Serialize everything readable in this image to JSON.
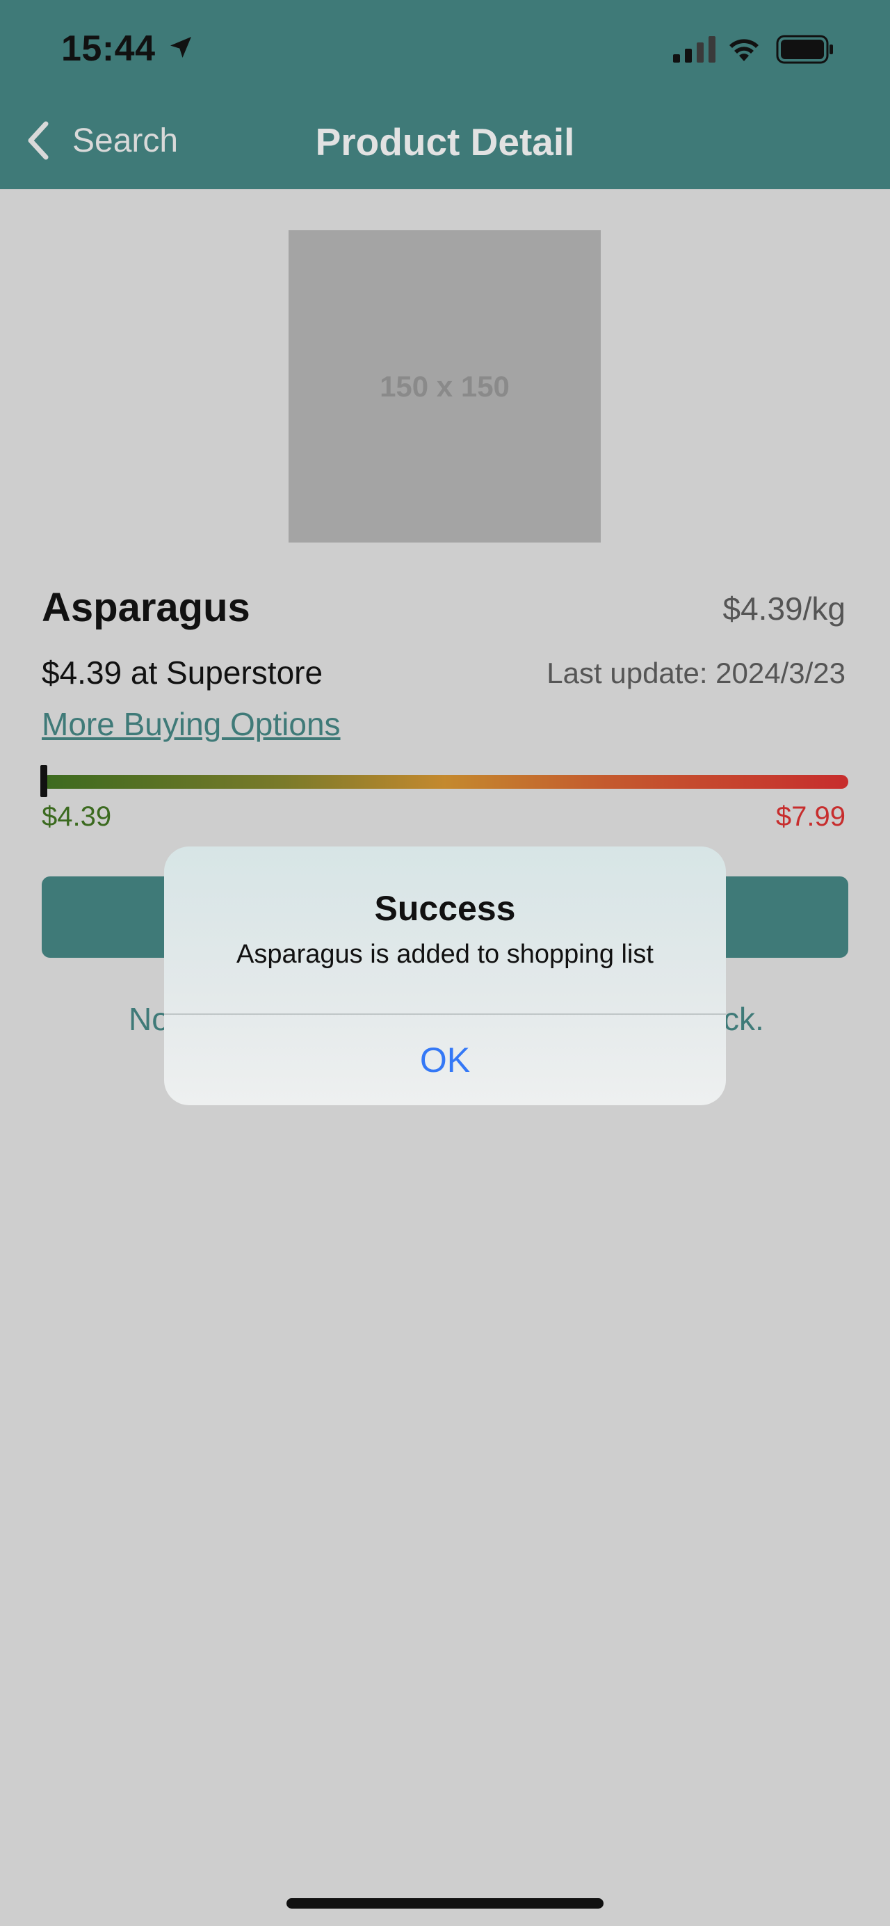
{
  "status_bar": {
    "time": "15:44",
    "icons": [
      "location-arrow-icon",
      "cellular-signal-icon",
      "wifi-icon",
      "battery-icon"
    ]
  },
  "nav": {
    "back_label": "Search",
    "title": "Product Detail",
    "back_icon": "chevron-left-icon"
  },
  "product": {
    "image_placeholder": "150 x 150",
    "name": "Asparagus",
    "unit_price": "$4.39/kg",
    "store_price": "$4.39 at Superstore",
    "last_update": "Last update: 2024/3/23",
    "more_options": "More Buying Options"
  },
  "price_range": {
    "min": "$4.39",
    "max": "$7.99",
    "current_position_fraction": 0.0,
    "min_color": "#3b6a1f",
    "max_color": "#c72d2d"
  },
  "background_note": {
    "left_fragment": "No",
    "right_fragment": "ck."
  },
  "alert": {
    "title": "Success",
    "message": "Asparagus is added to shopping list",
    "ok_label": "OK"
  },
  "colors": {
    "brand": "#3f7a78",
    "background": "#cecece",
    "link_blue": "#3478f6"
  }
}
